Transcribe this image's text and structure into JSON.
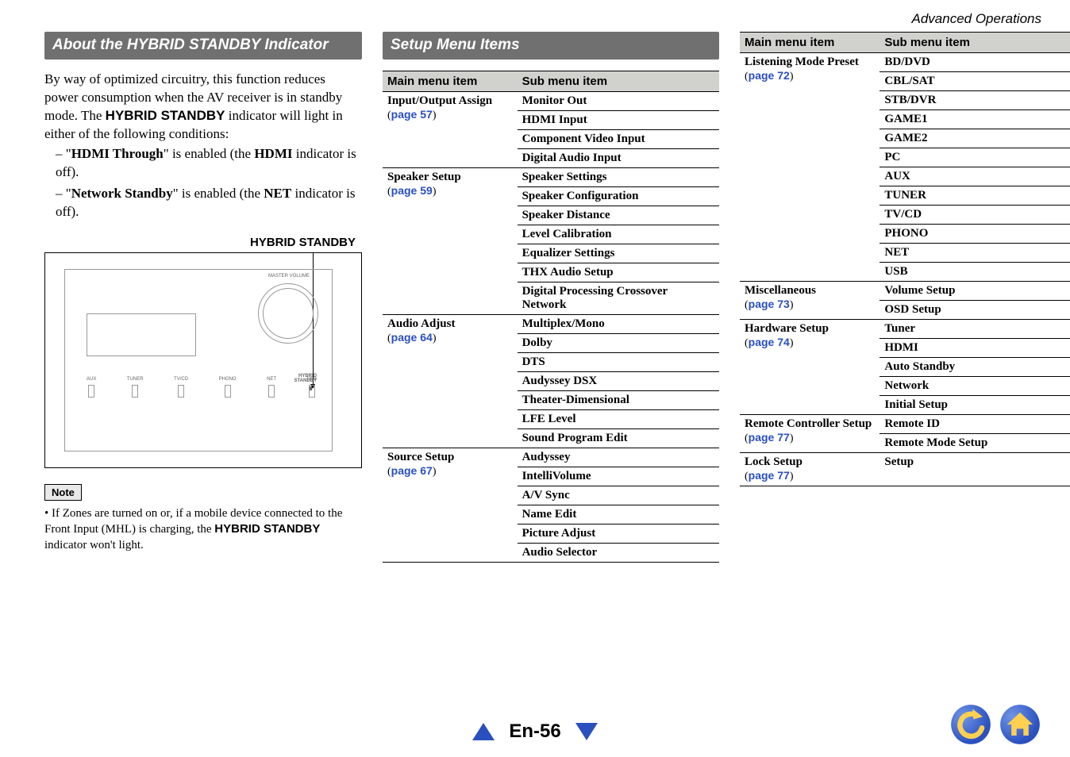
{
  "header": {
    "section": "Advanced Operations"
  },
  "col1": {
    "title": "About the HYBRID STANDBY Indicator",
    "p1a": "By way of optimized circuitry, this function reduces power consumption when the AV receiver is in standby mode.",
    "p1b_pre": "The ",
    "p1b_bold": "HYBRID STANDBY",
    "p1b_post": " indicator will light in either of the following conditions:",
    "li1_a": "\"",
    "li1_b": "HDMI Through",
    "li1_c": "\" is enabled (the ",
    "li1_d": "HDMI",
    "li1_e": " indicator is off).",
    "li2_a": "\"",
    "li2_b": "Network Standby",
    "li2_c": "\" is enabled (the ",
    "li2_d": "NET",
    "li2_e": " indicator is off).",
    "hybrid_label": "HYBRID STANDBY",
    "illus": {
      "dial_label": "MASTER VOLUME",
      "inputs": [
        "AUX",
        "TUNER",
        "TV/CD",
        "PHONO",
        "NET",
        "USB"
      ],
      "hs": "HYBRID\nSTANDBY"
    },
    "note_label": "Note",
    "note_text_a": "If Zones are turned on or, if a mobile device connected to the Front Input (MHL) is charging, the ",
    "note_text_b": "HYBRID STANDBY",
    "note_text_c": " indicator won't light."
  },
  "col2": {
    "title": "Setup Menu Items",
    "headers": {
      "main": "Main menu item",
      "sub": "Sub menu item"
    },
    "sections": [
      {
        "main": "Input/Output Assign",
        "page": "page 57",
        "subs": [
          "Monitor Out",
          "HDMI Input",
          "Component Video Input",
          "Digital Audio Input"
        ]
      },
      {
        "main": "Speaker Setup",
        "page": "page 59",
        "subs": [
          "Speaker Settings",
          "Speaker Configuration",
          "Speaker Distance",
          "Level Calibration",
          "Equalizer Settings",
          "THX Audio Setup",
          "Digital Processing Crossover Network"
        ]
      },
      {
        "main": "Audio Adjust",
        "page": "page 64",
        "subs": [
          "Multiplex/Mono",
          "Dolby",
          "DTS",
          "Audyssey DSX",
          "Theater-Dimensional",
          "LFE Level",
          "Sound Program Edit"
        ]
      },
      {
        "main": "Source Setup",
        "page": "page 67",
        "subs": [
          "Audyssey",
          "IntelliVolume",
          "A/V Sync",
          "Name Edit",
          "Picture Adjust",
          "Audio Selector"
        ]
      }
    ]
  },
  "col3": {
    "headers": {
      "main": "Main menu item",
      "sub": "Sub menu item"
    },
    "sections": [
      {
        "main": "Listening Mode Preset",
        "page": "page 72",
        "subs": [
          "BD/DVD",
          "CBL/SAT",
          "STB/DVR",
          "GAME1",
          "GAME2",
          "PC",
          "AUX",
          "TUNER",
          "TV/CD",
          "PHONO",
          "NET",
          "USB"
        ]
      },
      {
        "main": "Miscellaneous",
        "page": "page 73",
        "subs": [
          "Volume Setup",
          "OSD Setup"
        ]
      },
      {
        "main": "Hardware Setup",
        "page": "page 74",
        "subs": [
          "Tuner",
          "HDMI",
          "Auto Standby",
          "Network",
          "Initial Setup"
        ]
      },
      {
        "main": "Remote Controller Setup",
        "page": "page 77",
        "subs": [
          "Remote ID",
          "Remote Mode Setup"
        ]
      },
      {
        "main": "Lock Setup",
        "page": "page 77",
        "subs": [
          "Setup"
        ]
      }
    ]
  },
  "footer": {
    "page": "En-56"
  }
}
